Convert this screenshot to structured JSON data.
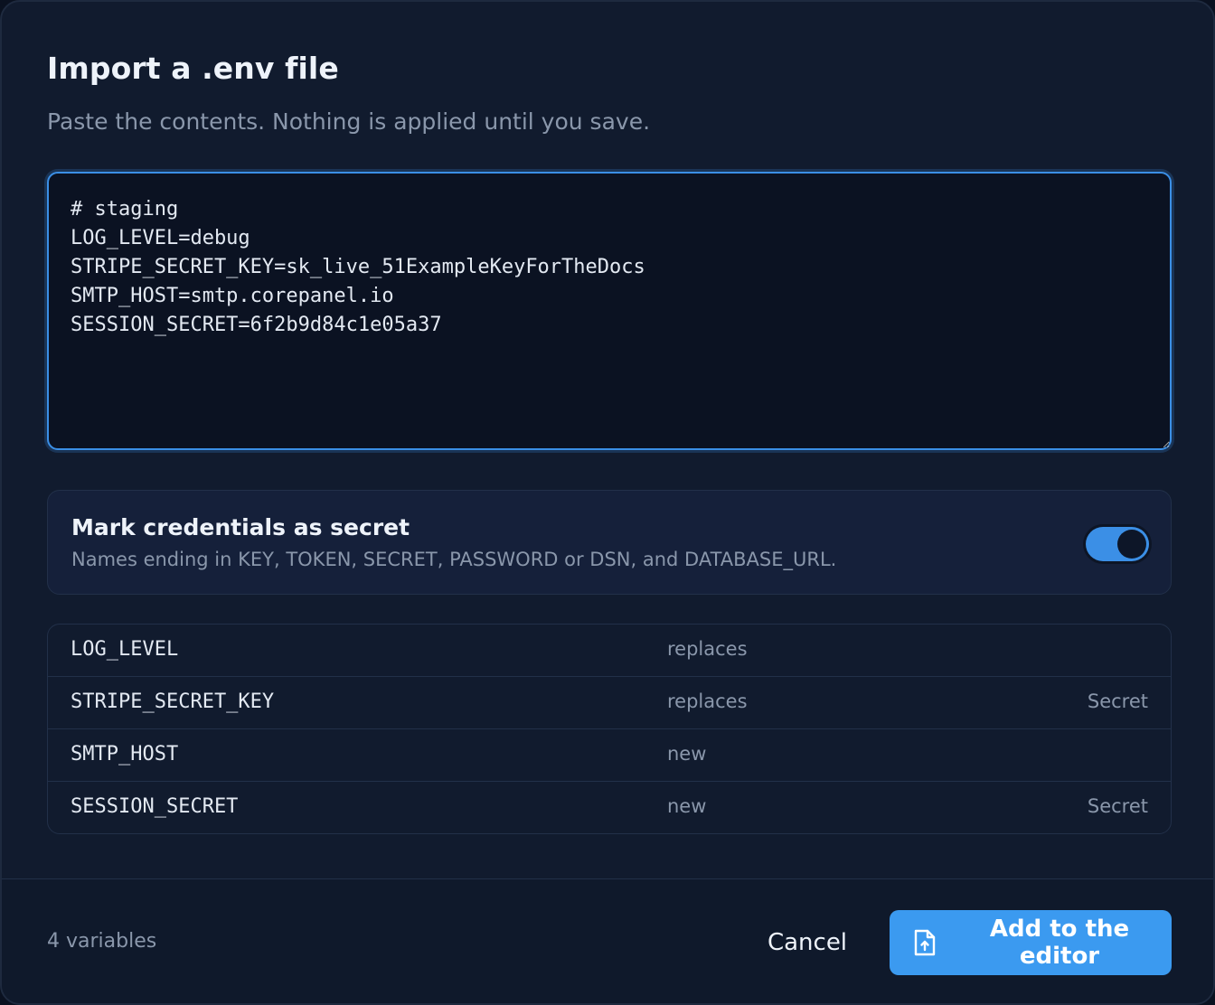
{
  "dialog": {
    "title": "Import a .env file",
    "subtitle": "Paste the contents. Nothing is applied until you save."
  },
  "editor": {
    "value": "# staging\nLOG_LEVEL=debug\nSTRIPE_SECRET_KEY=sk_live_51ExampleKeyForTheDocs\nSMTP_HOST=smtp.corepanel.io\nSESSION_SECRET=6f2b9d84c1e05a37"
  },
  "secret_option": {
    "title": "Mark credentials as secret",
    "description": "Names ending in KEY, TOKEN, SECRET, PASSWORD or DSN, and DATABASE_URL.",
    "enabled": true
  },
  "variables": [
    {
      "name": "LOG_LEVEL",
      "action": "replaces",
      "tag": ""
    },
    {
      "name": "STRIPE_SECRET_KEY",
      "action": "replaces",
      "tag": "Secret"
    },
    {
      "name": "SMTP_HOST",
      "action": "new",
      "tag": ""
    },
    {
      "name": "SESSION_SECRET",
      "action": "new",
      "tag": "Secret"
    }
  ],
  "footer": {
    "count_label": "4 variables",
    "cancel_label": "Cancel",
    "primary_label": "Add to the editor",
    "primary_icon": "file-upload-icon"
  },
  "colors": {
    "accent": "#3b9af0",
    "background": "#111b2e",
    "muted_text": "#8a97ab"
  }
}
